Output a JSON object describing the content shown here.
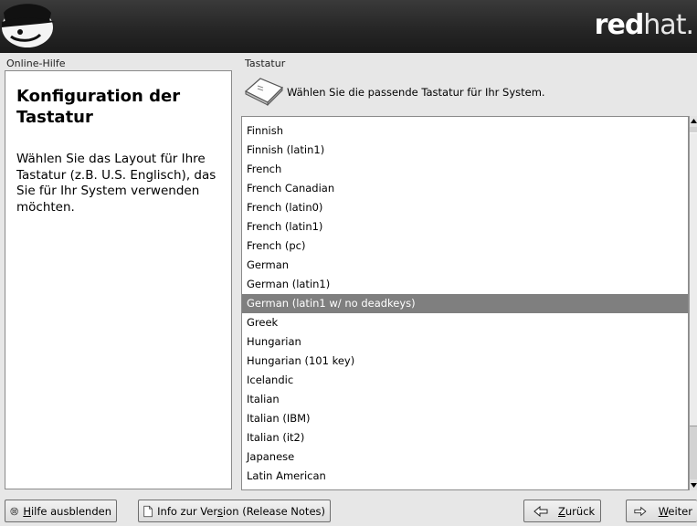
{
  "header": {
    "brand_bold": "red",
    "brand_light": "hat."
  },
  "help_panel": {
    "label": "Online-Hilfe",
    "title": "Konfiguration der Tastatur",
    "text": "Wählen Sie das Layout für Ihre Tastatur (z.B. U.S. Englisch), das Sie für Ihr System verwenden möchten."
  },
  "keyboard_panel": {
    "label": "Tastatur",
    "prompt": "Wählen Sie die passende Tastatur für Ihr System.",
    "icon": "keyboard-key-icon",
    "items": [
      "Finnish",
      "Finnish (latin1)",
      "French",
      "French Canadian",
      "French (latin0)",
      "French (latin1)",
      "French (pc)",
      "German",
      "German (latin1)",
      "German (latin1 w/ no deadkeys)",
      "Greek",
      "Hungarian",
      "Hungarian (101 key)",
      "Icelandic",
      "Italian",
      "Italian (IBM)",
      "Italian (it2)",
      "Japanese",
      "Latin American"
    ],
    "selected": "German (latin1 w/ no deadkeys)"
  },
  "buttons": {
    "hide_help": {
      "mnemonic": "H",
      "rest": "ilfe ausblenden",
      "icon": "help-hide-icon"
    },
    "release_notes": {
      "before": "Info zur Ver",
      "mnemonic": "s",
      "after": "ion (Release Notes)",
      "icon": "document-icon"
    },
    "back": {
      "mnemonic": "Z",
      "rest": "urück",
      "icon": "arrow-left-icon"
    },
    "next": {
      "mnemonic": "W",
      "rest": "eiter",
      "icon": "arrow-right-icon"
    }
  },
  "colors": {
    "banner": "#262626",
    "selection": "#7f7f7f",
    "background": "#e7e7e7"
  }
}
